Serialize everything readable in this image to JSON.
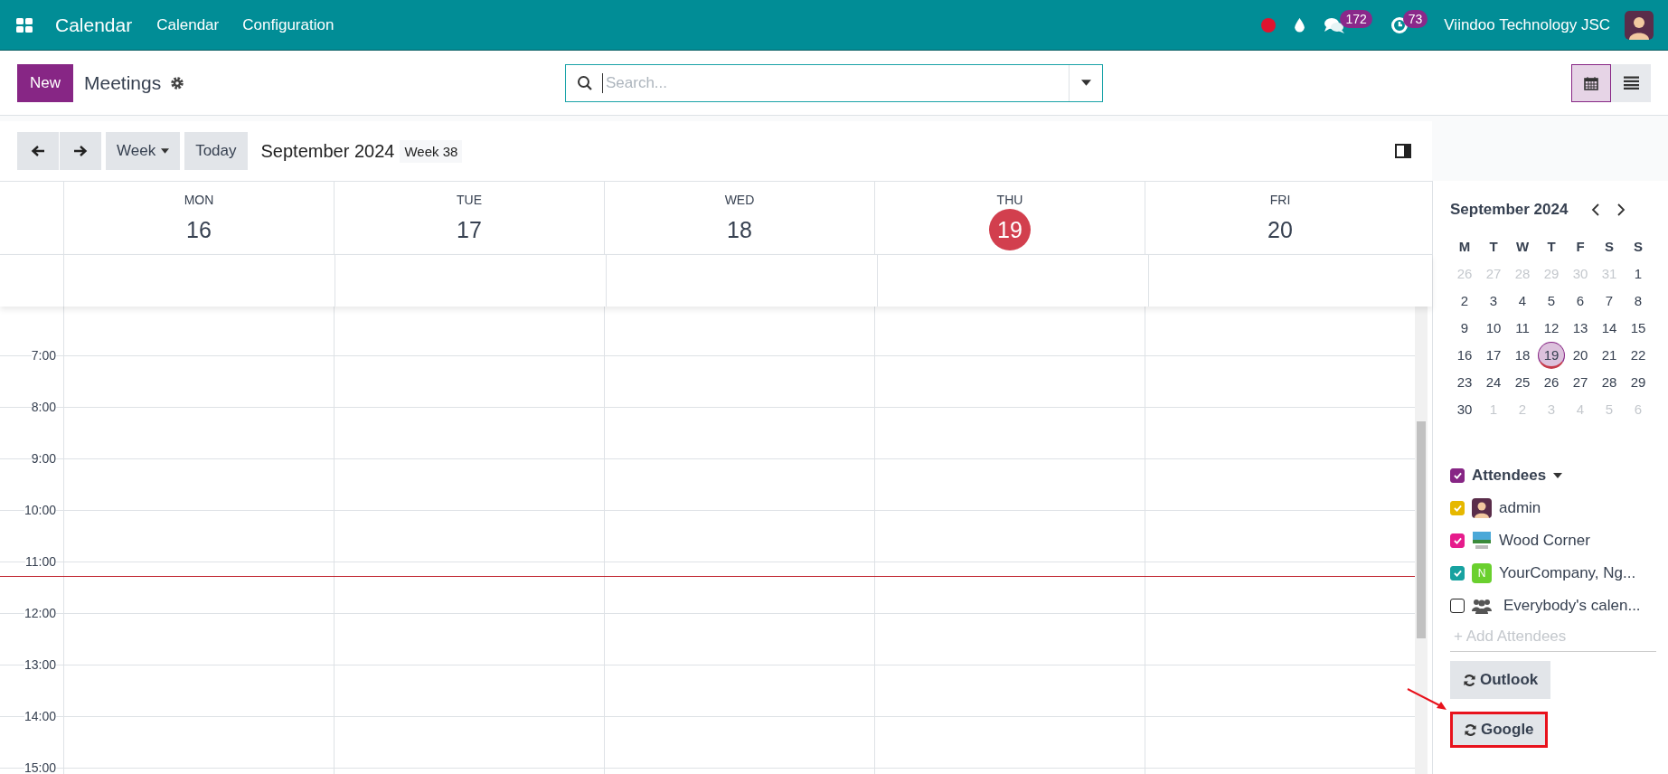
{
  "navbar": {
    "app_name": "Calendar",
    "menus": [
      "Calendar",
      "Configuration"
    ],
    "chat_badge": "172",
    "activity_badge": "73",
    "company": "Viindoo Technology JSC"
  },
  "control_panel": {
    "new_button": "New",
    "title": "Meetings",
    "search": {
      "placeholder": "Search..."
    },
    "views": [
      {
        "kind": "calendar",
        "selected": true
      },
      {
        "kind": "list",
        "selected": false
      }
    ]
  },
  "toolbar": {
    "scale": "Week",
    "today": "Today",
    "period": "September 2024",
    "week": "Week 38"
  },
  "days": [
    {
      "weekday": "MON",
      "date": "16",
      "selected": false
    },
    {
      "weekday": "TUE",
      "date": "17",
      "selected": false
    },
    {
      "weekday": "WED",
      "date": "18",
      "selected": false
    },
    {
      "weekday": "THU",
      "date": "19",
      "selected": true
    },
    {
      "weekday": "FRI",
      "date": "20",
      "selected": false
    }
  ],
  "hours": [
    {
      "label": "7:00",
      "now": false
    },
    {
      "label": "8:00",
      "now": false
    },
    {
      "label": "9:00",
      "now": false
    },
    {
      "label": "10:00",
      "now": false
    },
    {
      "label": "11:00",
      "now": true
    },
    {
      "label": "12:00",
      "now": false
    },
    {
      "label": "13:00",
      "now": false
    },
    {
      "label": "14:00",
      "now": false
    },
    {
      "label": "15:00",
      "now": false
    }
  ],
  "mini_calendar": {
    "title": "September 2024",
    "weekdays": [
      "M",
      "T",
      "W",
      "T",
      "F",
      "S",
      "S"
    ],
    "weeks": [
      [
        {
          "d": "26",
          "muted": true,
          "selected": false
        },
        {
          "d": "27",
          "muted": true,
          "selected": false
        },
        {
          "d": "28",
          "muted": true,
          "selected": false
        },
        {
          "d": "29",
          "muted": true,
          "selected": false
        },
        {
          "d": "30",
          "muted": true,
          "selected": false
        },
        {
          "d": "31",
          "muted": true,
          "selected": false
        },
        {
          "d": "1",
          "muted": false,
          "selected": false
        }
      ],
      [
        {
          "d": "2",
          "muted": false,
          "selected": false
        },
        {
          "d": "3",
          "muted": false,
          "selected": false
        },
        {
          "d": "4",
          "muted": false,
          "selected": false
        },
        {
          "d": "5",
          "muted": false,
          "selected": false
        },
        {
          "d": "6",
          "muted": false,
          "selected": false
        },
        {
          "d": "7",
          "muted": false,
          "selected": false
        },
        {
          "d": "8",
          "muted": false,
          "selected": false
        }
      ],
      [
        {
          "d": "9",
          "muted": false,
          "selected": false
        },
        {
          "d": "10",
          "muted": false,
          "selected": false
        },
        {
          "d": "11",
          "muted": false,
          "selected": false
        },
        {
          "d": "12",
          "muted": false,
          "selected": false
        },
        {
          "d": "13",
          "muted": false,
          "selected": false
        },
        {
          "d": "14",
          "muted": false,
          "selected": false
        },
        {
          "d": "15",
          "muted": false,
          "selected": false
        }
      ],
      [
        {
          "d": "16",
          "muted": false,
          "selected": false
        },
        {
          "d": "17",
          "muted": false,
          "selected": false
        },
        {
          "d": "18",
          "muted": false,
          "selected": false
        },
        {
          "d": "19",
          "muted": false,
          "selected": true
        },
        {
          "d": "20",
          "muted": false,
          "selected": false
        },
        {
          "d": "21",
          "muted": false,
          "selected": false
        },
        {
          "d": "22",
          "muted": false,
          "selected": false
        }
      ],
      [
        {
          "d": "23",
          "muted": false,
          "selected": false
        },
        {
          "d": "24",
          "muted": false,
          "selected": false
        },
        {
          "d": "25",
          "muted": false,
          "selected": false
        },
        {
          "d": "26",
          "muted": false,
          "selected": false
        },
        {
          "d": "27",
          "muted": false,
          "selected": false
        },
        {
          "d": "28",
          "muted": false,
          "selected": false
        },
        {
          "d": "29",
          "muted": false,
          "selected": false
        }
      ],
      [
        {
          "d": "30",
          "muted": false,
          "selected": false
        },
        {
          "d": "1",
          "muted": true,
          "selected": false
        },
        {
          "d": "2",
          "muted": true,
          "selected": false
        },
        {
          "d": "3",
          "muted": true,
          "selected": false
        },
        {
          "d": "4",
          "muted": true,
          "selected": false
        },
        {
          "d": "5",
          "muted": true,
          "selected": false
        },
        {
          "d": "6",
          "muted": true,
          "selected": false
        }
      ]
    ]
  },
  "attendees": {
    "title": "Attendees",
    "checked": true,
    "color": "#872685",
    "items": [
      {
        "kind": "avatar",
        "name": "admin",
        "checked": true,
        "color": "#e6b800"
      },
      {
        "kind": "image",
        "name": "Wood Corner",
        "checked": true,
        "color": "#e61c8c"
      },
      {
        "kind": "initial",
        "initial": "N",
        "name": "YourCompany, Ng...",
        "checked": true,
        "color": "#17a2a0"
      },
      {
        "kind": "group",
        "name": "Everybody's calen...",
        "checked": false
      }
    ],
    "add_placeholder": "+ Add Attendees"
  },
  "sync_buttons": [
    {
      "label": "Outlook",
      "highlighted": false
    },
    {
      "label": "Google",
      "highlighted": true
    }
  ]
}
